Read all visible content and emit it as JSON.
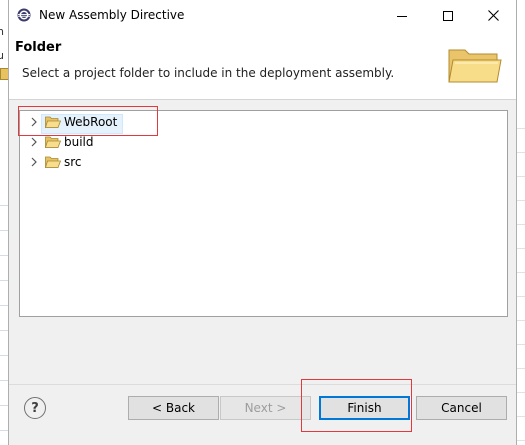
{
  "window": {
    "title": "New Assembly Directive"
  },
  "banner": {
    "title": "Folder",
    "description": "Select a project folder to include in the deployment assembly."
  },
  "tree": {
    "items": [
      {
        "label": "WebRoot",
        "selected": true
      },
      {
        "label": "build",
        "selected": false
      },
      {
        "label": "src",
        "selected": false
      }
    ]
  },
  "buttons": {
    "help": "?",
    "back": "< Back",
    "next": "Next >",
    "finish": "Finish",
    "cancel": "Cancel"
  },
  "background": {
    "left_fragments": [
      "n",
      "u"
    ]
  },
  "colors": {
    "selection": "#e5f1fb",
    "annotation": "#e0393e",
    "default_button_border": "#0078d7"
  }
}
